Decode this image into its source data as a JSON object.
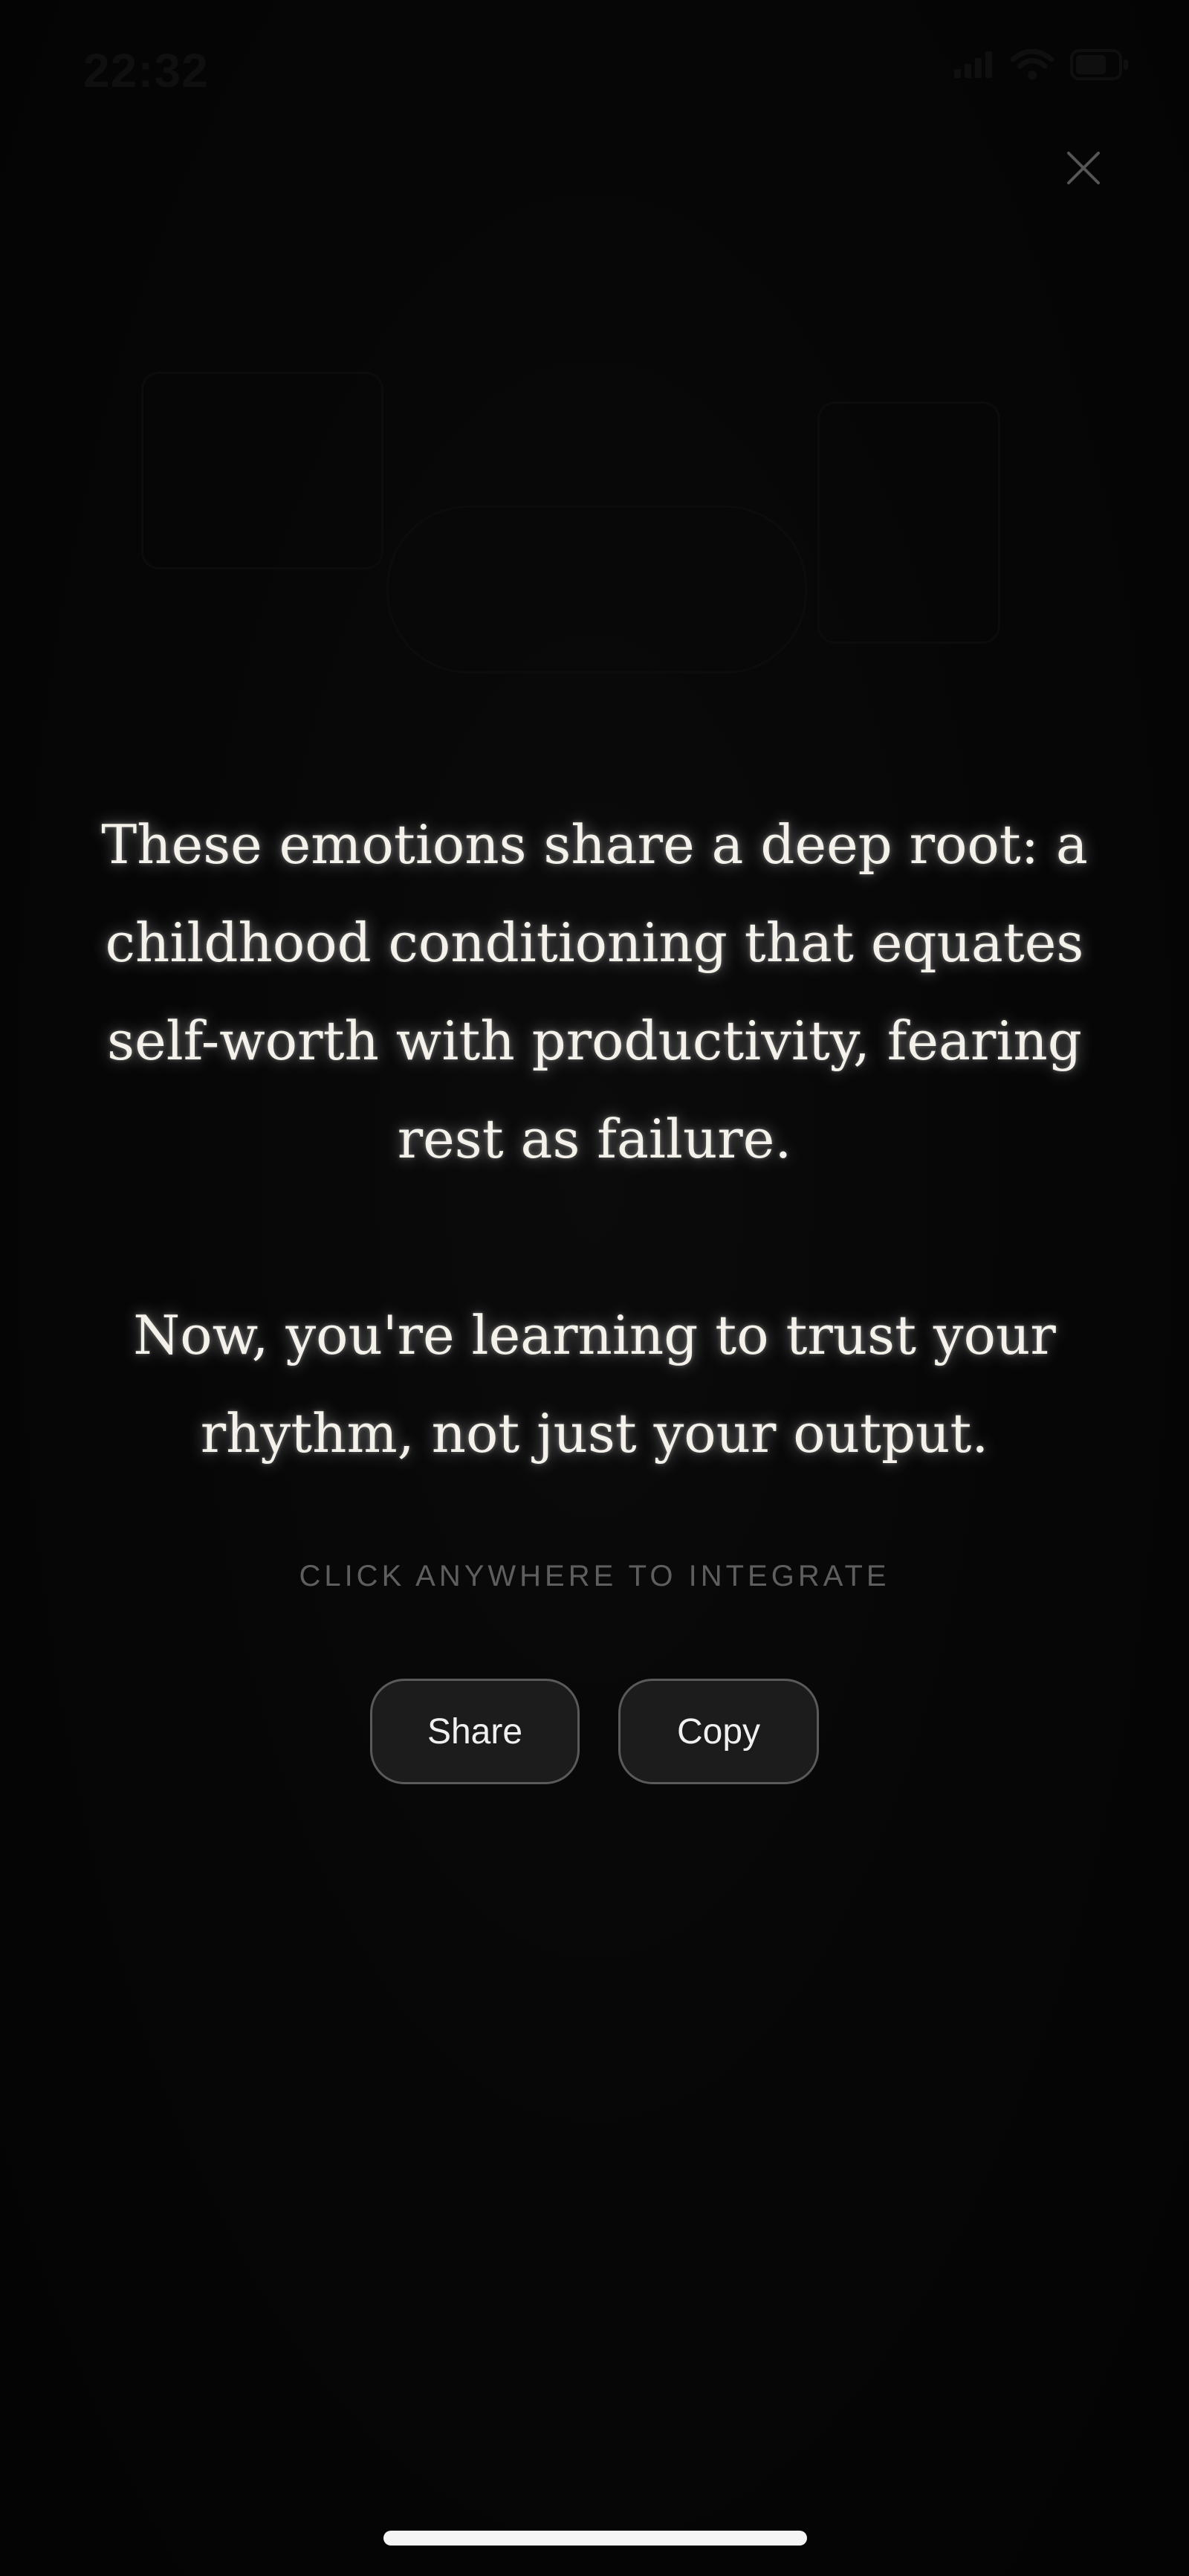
{
  "status_bar": {
    "time": "22:32",
    "icons": [
      "signal-icon",
      "wifi-icon",
      "battery-icon"
    ]
  },
  "close": {
    "icon": "close-icon"
  },
  "message": {
    "paragraph_1": "These emotions share a deep root: a childhood conditioning that equates self-worth with productivity, fearing rest as failure.",
    "paragraph_2": "Now, you're learning to trust your rhythm, not just your output."
  },
  "hint": "CLICK ANYWHERE TO INTEGRATE",
  "actions": {
    "share_label": "Share",
    "copy_label": "Copy"
  },
  "colors": {
    "background": "#050505",
    "text": "#f4f0ea",
    "hint": "#5e5e5e",
    "button_bg": "#1c1c1c",
    "button_border": "#5a5a5a"
  }
}
